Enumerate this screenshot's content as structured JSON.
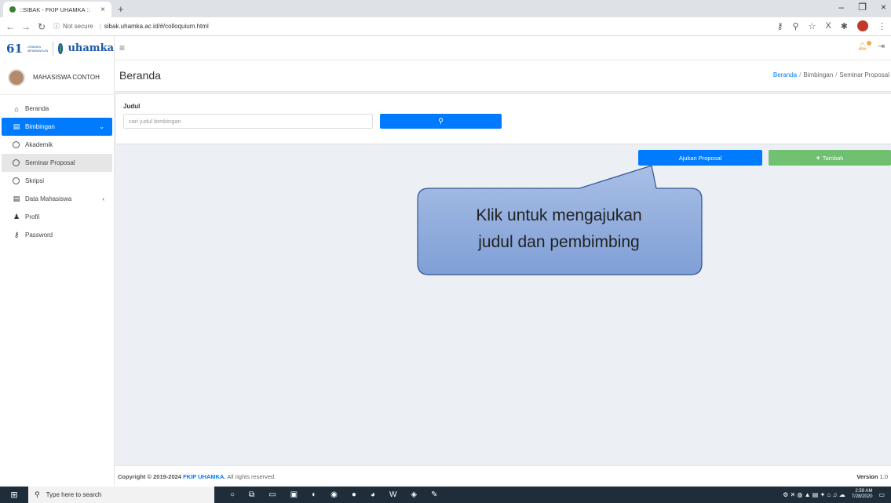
{
  "browser": {
    "tab_title": "::SIBAK - FKIP UHAMKA ::",
    "security": "Not secure",
    "url": "sibak.uhamka.ac.id/#/colloquium.html"
  },
  "header": {
    "logo_text": "uhamka",
    "logo_number": "61",
    "logo_mini": "UHAMKA MEMBANGUN"
  },
  "sidebar": {
    "user_name": "MAHASISWA CONTOH",
    "items": [
      {
        "label": "Beranda",
        "icon": "home-icon"
      },
      {
        "label": "Bimbingan",
        "icon": "book-icon"
      },
      {
        "label": "Akademik",
        "icon": "circle-icon"
      },
      {
        "label": "Seminar Proposal",
        "icon": "circle-icon"
      },
      {
        "label": "Skripsi",
        "icon": "circle-icon"
      },
      {
        "label": "Data Mahasiswa",
        "icon": "book-icon"
      },
      {
        "label": "Profil",
        "icon": "user-icon"
      },
      {
        "label": "Password",
        "icon": "key-icon"
      }
    ]
  },
  "content": {
    "page_title": "Beranda",
    "breadcrumb": [
      "Beranda",
      "Bimbingan",
      "Seminar Proposal"
    ],
    "judul_label": "Judul",
    "search_placeholder": "cari judul bimbingan",
    "ajukan_label": "Ajukan Proposal",
    "tambah_label": "Tambah"
  },
  "callout": {
    "line1": "Klik untuk mengajukan",
    "line2": "judul dan pembimbing"
  },
  "footer": {
    "copyright_prefix": "Copyright © 2019-2024",
    "org": "FKIP UHAMKA.",
    "rights": "All rights reserved.",
    "version_label": "Version",
    "version_value": "1.0"
  },
  "taskbar": {
    "search_placeholder": "Type here to search",
    "time": "2:59 AM",
    "date": "7/28/2020"
  },
  "colors": {
    "primary": "#007bff",
    "success": "#5cb85c",
    "callout_fill": "#8faadc",
    "callout_stroke": "#2f5597"
  }
}
